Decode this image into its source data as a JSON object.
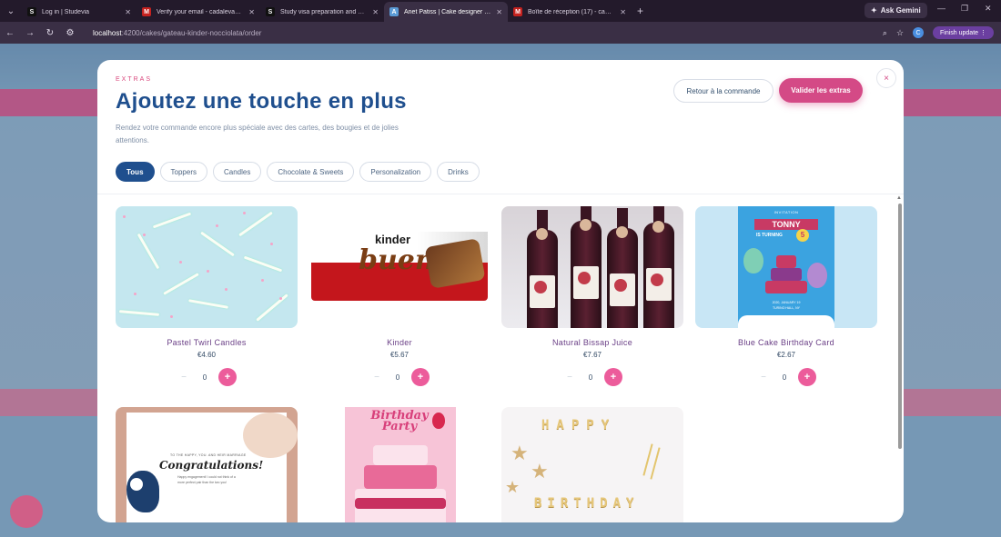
{
  "browser": {
    "tabs": [
      {
        "title": "Log in | Studevia",
        "favicon": "S",
        "color": "#111111"
      },
      {
        "title": "Verify your email - cadalevans5@",
        "favicon": "M",
        "color": "#c5221f"
      },
      {
        "title": "Study visa preparation and emi",
        "favicon": "S",
        "color": "#111111"
      },
      {
        "title": "Anet Patiss | Cake designer & p",
        "favicon": "A",
        "color": "#5b9bd5"
      },
      {
        "title": "Boîte de réception (17) - cadale",
        "favicon": "M",
        "color": "#c5221f"
      }
    ],
    "ask_label": "Ask Gemini",
    "url_host": "localhost",
    "url_rest": ":4200/cakes/gateau-kinder-nocciolata/order",
    "profile_initial": "C",
    "finish_label": "Finish update"
  },
  "modal": {
    "eyebrow": "EXTRAS",
    "title": "Ajoutez une touche en plus",
    "subtitle": "Rendez votre commande encore plus spéciale avec des cartes, des bougies et de jolies attentions.",
    "back_label": "Retour à la commande",
    "validate_label": "Valider les extras",
    "close_icon": "×",
    "filters": [
      "Tous",
      "Toppers",
      "Candles",
      "Chocolate & Sweets",
      "Personalization",
      "Drinks"
    ],
    "products": [
      {
        "name": "Pastel Twirl Candles",
        "price": "€4.60",
        "qty": "0"
      },
      {
        "name": "Kinder",
        "price": "€5.67",
        "qty": "0"
      },
      {
        "name": "Natural Bissap Juice",
        "price": "€7.67",
        "qty": "0"
      },
      {
        "name": "Blue Cake Birthday Card",
        "price": "€2.67",
        "qty": "0"
      }
    ],
    "stepper": {
      "minus": "−",
      "plus": "+"
    },
    "images": {
      "kinder_word": "kinder",
      "bueno_word": "bueno",
      "card_invitation": "INVITATION",
      "card_name": "TONNY",
      "card_turning": "IS TURNING",
      "card_age": "5",
      "card_date": "2020, JANUARY 19",
      "card_place": "TURINO HALL, NY",
      "congrats_small": "TO THE HAPPY, YOU. AND HEIR MARRIAGE",
      "congrats_title": "Congratulations!",
      "congrats_line1": "Happy engagement! I could not think of a",
      "congrats_line2": "more perfect pair than the two you!",
      "party_title": "Birthday Party",
      "happy_word": "HAPPY",
      "birthday_word": "BIRTHDAY"
    }
  }
}
